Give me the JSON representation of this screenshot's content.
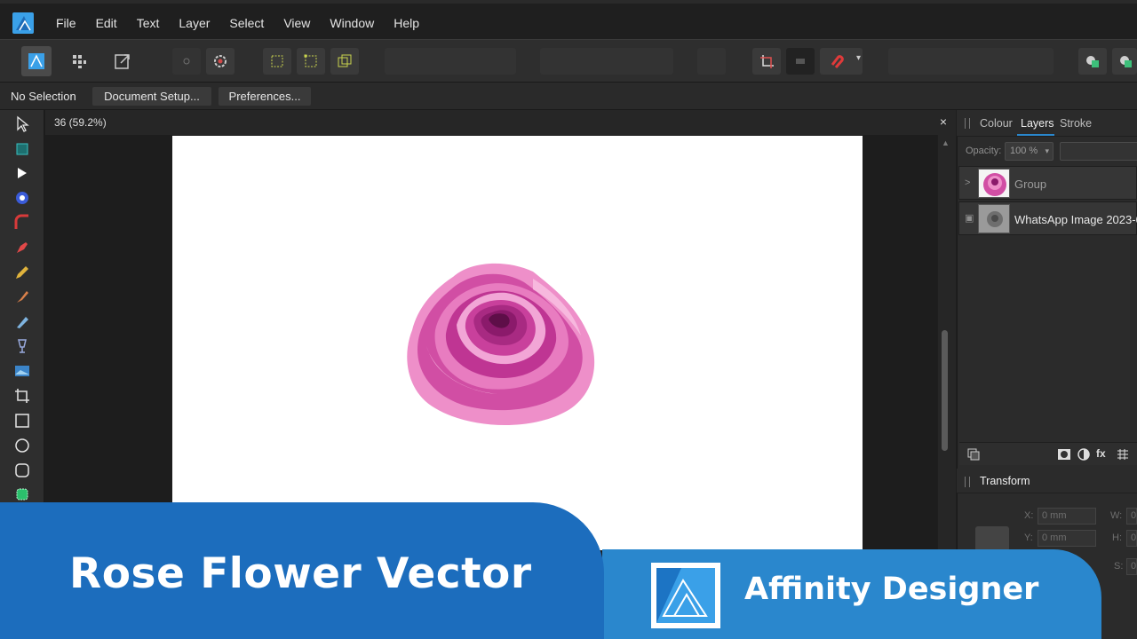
{
  "menu": [
    "File",
    "Edit",
    "Text",
    "Layer",
    "Select",
    "View",
    "Window",
    "Help"
  ],
  "context": {
    "selection": "No Selection",
    "document_setup": "Document Setup...",
    "preferences": "Preferences..."
  },
  "document": {
    "tab_title": "36 (59.2%)",
    "close_symbol": "×"
  },
  "panel": {
    "tabs": [
      "Colour",
      "Layers",
      "Stroke"
    ],
    "active_tab": "Layers",
    "opacity_label": "Opacity:",
    "opacity_value": "100 %",
    "layers": [
      {
        "name": "Group",
        "expander": ">"
      },
      {
        "name": "WhatsApp Image 2023-0"
      }
    ]
  },
  "transform": {
    "title": "Transform",
    "x_label": "X:",
    "x_value": "0 mm",
    "y_label": "Y:",
    "y_value": "0 mm",
    "w_label": "W:",
    "w_value": "0",
    "h_label": "H:",
    "h_value": "0",
    "s_label": "S:",
    "s_value": "0"
  },
  "banner": {
    "title": "Rose Flower Vector",
    "subtitle": "Affinity Designer"
  },
  "colors": {
    "accent": "#2a87cd",
    "banner_dark": "#1c6dbd",
    "rose_dark": "#9c1a72",
    "rose_mid": "#d14ea4",
    "rose_light": "#ee8fc9"
  }
}
